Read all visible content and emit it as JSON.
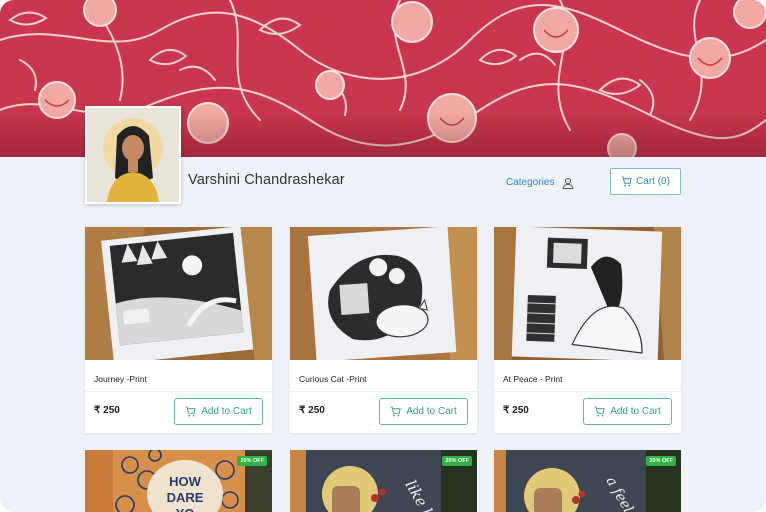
{
  "store": {
    "name": "Varshini Chandrashekar"
  },
  "nav": {
    "categories_label": "Categories",
    "cart_label": "Cart (0)"
  },
  "products": [
    {
      "title": "Journey -Print",
      "price": "₹ 250",
      "button": "Add to Cart"
    },
    {
      "title": "Curious Cat -Print",
      "price": "₹ 250",
      "button": "Add to Cart"
    },
    {
      "title": "At Peace - Print",
      "price": "₹ 250",
      "button": "Add to Cart"
    }
  ],
  "products_row2": [
    {
      "badge": "20% OFF",
      "cover_text": "HOW DARE YO"
    },
    {
      "badge": "20% OFF",
      "cover_text": "like lo"
    },
    {
      "badge": "20% OFF",
      "cover_text": "a feel"
    }
  ],
  "colors": {
    "banner": "#c9364d",
    "accent_blue": "#2e86c9",
    "accent_teal": "#37a08c",
    "badge_green": "#2fb344"
  }
}
